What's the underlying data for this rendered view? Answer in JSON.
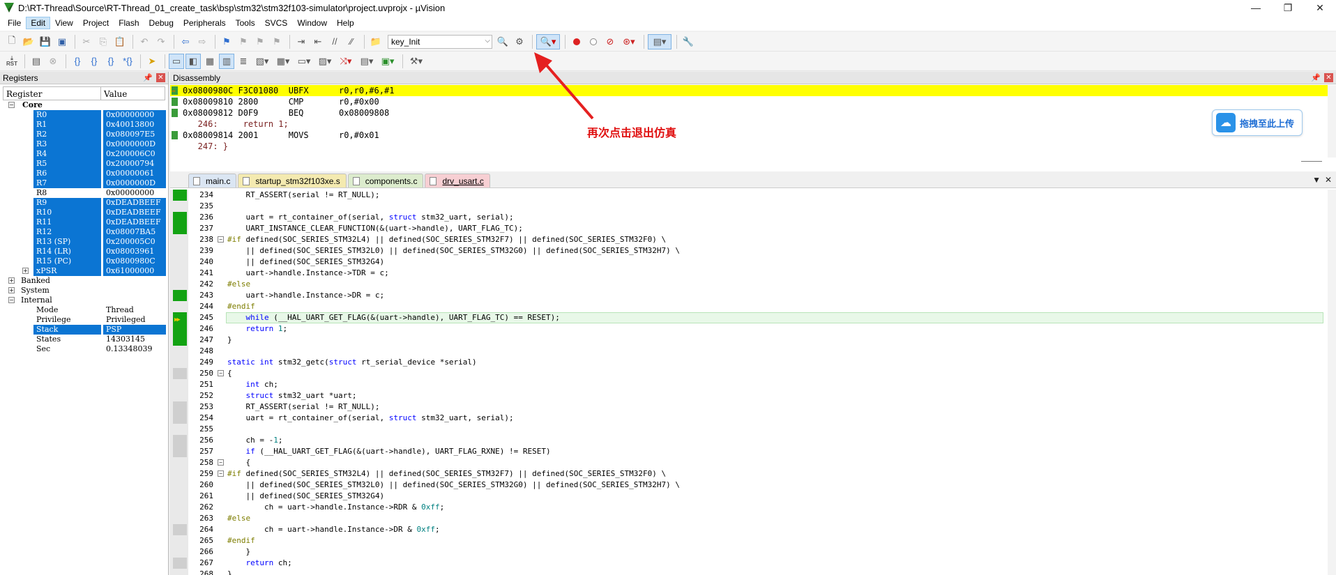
{
  "window": {
    "title": "D:\\RT-Thread\\Source\\RT-Thread_01_create_task\\bsp\\stm32\\stm32f103-simulator\\project.uvprojx - µVision",
    "minimize": "—",
    "maximize": "❐",
    "close": "✕"
  },
  "menu": [
    "File",
    "Edit",
    "View",
    "Project",
    "Flash",
    "Debug",
    "Peripherals",
    "Tools",
    "SVCS",
    "Window",
    "Help"
  ],
  "toolbar": {
    "target": "key_Init",
    "rst_label": "RST"
  },
  "registers": {
    "title": "Registers",
    "col_register": "Register",
    "col_value": "Value",
    "core_label": "Core",
    "core": [
      {
        "name": "R0",
        "value": "0x00000000",
        "sel": true
      },
      {
        "name": "R1",
        "value": "0x40013800",
        "sel": true
      },
      {
        "name": "R2",
        "value": "0x080097E5",
        "sel": true
      },
      {
        "name": "R3",
        "value": "0x0000000D",
        "sel": true
      },
      {
        "name": "R4",
        "value": "0x200006C0",
        "sel": true
      },
      {
        "name": "R5",
        "value": "0x20000794",
        "sel": true
      },
      {
        "name": "R6",
        "value": "0x00000061",
        "sel": true
      },
      {
        "name": "R7",
        "value": "0x0000000D",
        "sel": true
      },
      {
        "name": "R8",
        "value": "0x00000000",
        "sel": false
      },
      {
        "name": "R9",
        "value": "0xDEADBEEF",
        "sel": true
      },
      {
        "name": "R10",
        "value": "0xDEADBEEF",
        "sel": true
      },
      {
        "name": "R11",
        "value": "0xDEADBEEF",
        "sel": true
      },
      {
        "name": "R12",
        "value": "0x08007BA5",
        "sel": true
      },
      {
        "name": "R13 (SP)",
        "value": "0x200005C0",
        "sel": true
      },
      {
        "name": "R14 (LR)",
        "value": "0x08003961",
        "sel": true
      },
      {
        "name": "R15 (PC)",
        "value": "0x0800980C",
        "sel": true
      },
      {
        "name": "xPSR",
        "value": "0x61000000",
        "sel": true
      }
    ],
    "banked_label": "Banked",
    "system_label": "System",
    "internal_label": "Internal",
    "internal": [
      {
        "name": "Mode",
        "value": "Thread",
        "sel": false
      },
      {
        "name": "Privilege",
        "value": "Privileged",
        "sel": false
      },
      {
        "name": "Stack",
        "value": "PSP",
        "sel": true
      },
      {
        "name": "States",
        "value": "14303145",
        "sel": false
      },
      {
        "name": "Sec",
        "value": "0.13348039",
        "sel": false
      }
    ]
  },
  "disassembly": {
    "title": "Disassembly",
    "lines": [
      {
        "text": "0x0800980C F3C01080  UBFX      r0,r0,#6,#1",
        "type": "cur"
      },
      {
        "text": "0x08009810 2800      CMP       r0,#0x00",
        "type": "asm"
      },
      {
        "text": "0x08009812 D0F9      BEQ       0x08009808",
        "type": "asm"
      },
      {
        "text": "   246:     return 1;",
        "type": "src"
      },
      {
        "text": "0x08009814 2001      MOVS      r0,#0x01",
        "type": "asm"
      },
      {
        "text": "   247: }",
        "type": "src"
      }
    ]
  },
  "annotation": {
    "text": "再次点击退出仿真",
    "upload_label": "拖拽至此上传"
  },
  "tabs": [
    {
      "label": "main.c",
      "cls": "t1"
    },
    {
      "label": "startup_stm32f103xe.s",
      "cls": "t2"
    },
    {
      "label": "components.c",
      "cls": "t3"
    },
    {
      "label": "drv_usart.c",
      "cls": "t4"
    }
  ],
  "code": [
    {
      "n": "234",
      "m": "g",
      "f": "",
      "t": "    RT_ASSERT(serial != RT_NULL);"
    },
    {
      "n": "235",
      "m": "",
      "f": "",
      "t": ""
    },
    {
      "n": "236",
      "m": "g",
      "f": "",
      "t": "    uart = rt_container_of(serial, struct stm32_uart, serial);"
    },
    {
      "n": "237",
      "m": "g",
      "f": "",
      "t": "    UART_INSTANCE_CLEAR_FUNCTION(&(uart->handle), UART_FLAG_TC);"
    },
    {
      "n": "238",
      "m": "",
      "f": "−",
      "t": "#if defined(SOC_SERIES_STM32L4) || defined(SOC_SERIES_STM32F7) || defined(SOC_SERIES_STM32F0) \\"
    },
    {
      "n": "239",
      "m": "",
      "f": "",
      "t": "    || defined(SOC_SERIES_STM32L0) || defined(SOC_SERIES_STM32G0) || defined(SOC_SERIES_STM32H7) \\"
    },
    {
      "n": "240",
      "m": "",
      "f": "",
      "t": "    || defined(SOC_SERIES_STM32G4)"
    },
    {
      "n": "241",
      "m": "",
      "f": "",
      "t": "    uart->handle.Instance->TDR = c;"
    },
    {
      "n": "242",
      "m": "",
      "f": "",
      "t": "#else"
    },
    {
      "n": "243",
      "m": "g",
      "f": "",
      "t": "    uart->handle.Instance->DR = c;"
    },
    {
      "n": "244",
      "m": "",
      "f": "",
      "t": "#endif"
    },
    {
      "n": "245",
      "m": "g",
      "f": "",
      "t": "    while (__HAL_UART_GET_FLAG(&(uart->handle), UART_FLAG_TC) == RESET);",
      "cur": true
    },
    {
      "n": "246",
      "m": "g",
      "f": "",
      "t": "    return 1;"
    },
    {
      "n": "247",
      "m": "g",
      "f": "",
      "t": "}"
    },
    {
      "n": "248",
      "m": "",
      "f": "",
      "t": ""
    },
    {
      "n": "249",
      "m": "",
      "f": "",
      "t": "static int stm32_getc(struct rt_serial_device *serial)"
    },
    {
      "n": "250",
      "m": "gr",
      "f": "−",
      "t": "{"
    },
    {
      "n": "251",
      "m": "",
      "f": "",
      "t": "    int ch;"
    },
    {
      "n": "252",
      "m": "",
      "f": "",
      "t": "    struct stm32_uart *uart;"
    },
    {
      "n": "253",
      "m": "gr",
      "f": "",
      "t": "    RT_ASSERT(serial != RT_NULL);"
    },
    {
      "n": "254",
      "m": "gr",
      "f": "",
      "t": "    uart = rt_container_of(serial, struct stm32_uart, serial);"
    },
    {
      "n": "255",
      "m": "",
      "f": "",
      "t": ""
    },
    {
      "n": "256",
      "m": "gr",
      "f": "",
      "t": "    ch = -1;"
    },
    {
      "n": "257",
      "m": "gr",
      "f": "",
      "t": "    if (__HAL_UART_GET_FLAG(&(uart->handle), UART_FLAG_RXNE) != RESET)"
    },
    {
      "n": "258",
      "m": "",
      "f": "−",
      "t": "    {"
    },
    {
      "n": "259",
      "m": "",
      "f": "−",
      "t": "#if defined(SOC_SERIES_STM32L4) || defined(SOC_SERIES_STM32F7) || defined(SOC_SERIES_STM32F0) \\"
    },
    {
      "n": "260",
      "m": "",
      "f": "",
      "t": "    || defined(SOC_SERIES_STM32L0) || defined(SOC_SERIES_STM32G0) || defined(SOC_SERIES_STM32H7) \\"
    },
    {
      "n": "261",
      "m": "",
      "f": "",
      "t": "    || defined(SOC_SERIES_STM32G4)"
    },
    {
      "n": "262",
      "m": "",
      "f": "",
      "t": "        ch = uart->handle.Instance->RDR & 0xff;"
    },
    {
      "n": "263",
      "m": "",
      "f": "",
      "t": "#else"
    },
    {
      "n": "264",
      "m": "gr",
      "f": "",
      "t": "        ch = uart->handle.Instance->DR & 0xff;"
    },
    {
      "n": "265",
      "m": "",
      "f": "",
      "t": "#endif"
    },
    {
      "n": "266",
      "m": "",
      "f": "",
      "t": "    }"
    },
    {
      "n": "267",
      "m": "gr",
      "f": "",
      "t": "    return ch;"
    },
    {
      "n": "268",
      "m": "",
      "f": "",
      "t": "}"
    }
  ]
}
